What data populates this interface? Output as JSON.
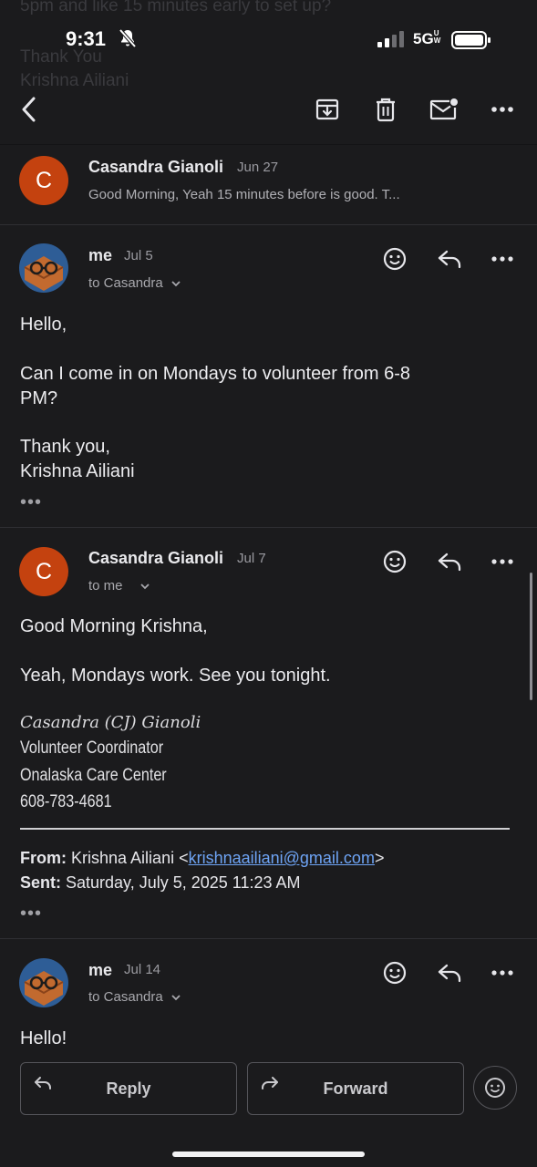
{
  "status_bar": {
    "time": "9:31",
    "network": "5G",
    "network_suffix": "UW"
  },
  "ghost_text": {
    "line1": "5pm and like 15 minutes early to set up?",
    "line2": "Thank You",
    "line3": "Krishna Ailiani"
  },
  "toolbar": {
    "back_icon": "chevron-left-icon",
    "archive_icon": "archive-icon",
    "delete_icon": "trash-icon",
    "mark_unread_icon": "mail-unread-icon",
    "more_icon": "more-horizontal-icon"
  },
  "messages": [
    {
      "sender": "Casandra Gianoli",
      "avatar_letter": "C",
      "date": "Jun 27",
      "snippet": "Good Morning, Yeah 15 minutes before is good. T..."
    },
    {
      "sender": "me",
      "date": "Jul 5",
      "to": "to Casandra",
      "body": [
        "Hello,",
        "Can I come in on Mondays to volunteer from 6-8",
        "PM?",
        "Thank you,",
        "Krishna Ailiani"
      ],
      "ellipsis": "•••"
    },
    {
      "sender": "Casandra Gianoli",
      "avatar_letter": "C",
      "date": "Jul 7",
      "to": "to me",
      "body": [
        "Good Morning Krishna,",
        "Yeah, Mondays work. See you tonight."
      ],
      "signature": {
        "script_name": "Casandra (CJ) Gianoli",
        "title": "Volunteer Coordinator",
        "org": "Onalaska Care Center",
        "phone": "608-783-4681"
      },
      "quoted": {
        "from_label": "From:",
        "from_name": "Krishna Ailiani <",
        "from_email": "krishnaailiani@gmail.com",
        "from_close": ">",
        "sent_label": "Sent:",
        "sent_value": "Saturday, July 5, 2025 11:23 AM"
      },
      "ellipsis": "•••"
    },
    {
      "sender": "me",
      "date": "Jul 14",
      "to": "to Casandra",
      "body": [
        "Hello!"
      ]
    }
  ],
  "bottom_actions": {
    "reply_label": "Reply",
    "forward_label": "Forward",
    "emoji_icon": "emoji-react-icon"
  },
  "colors": {
    "background": "#1b1b1d",
    "avatar": "#c4420f",
    "link": "#6ea4f5"
  }
}
